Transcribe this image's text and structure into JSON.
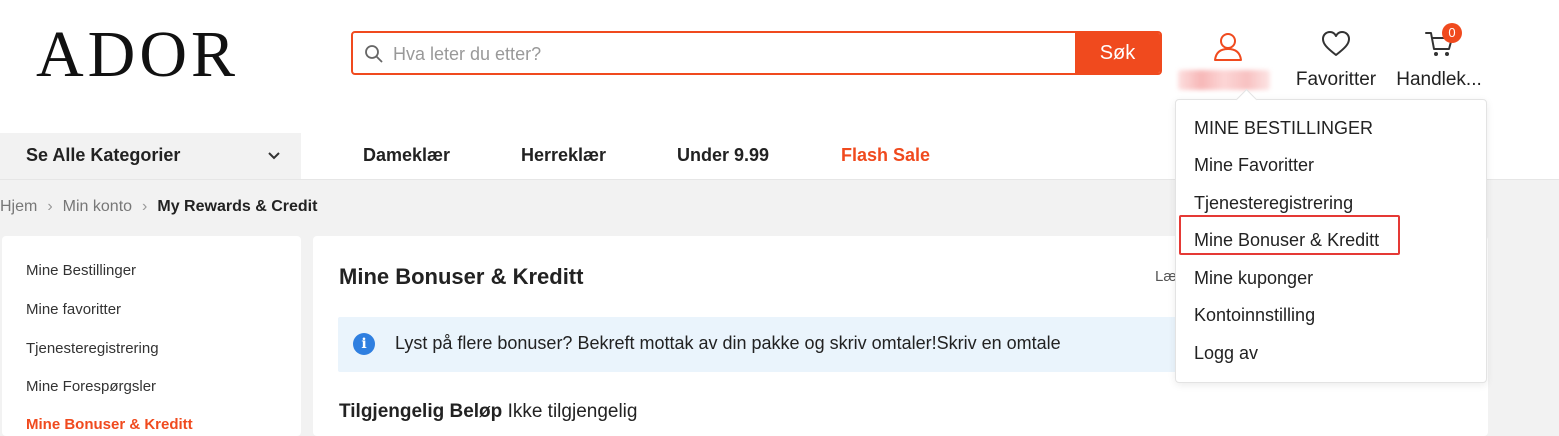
{
  "logo": "ADOR",
  "search": {
    "placeholder": "Hva leter du etter?",
    "button_label": "Søk"
  },
  "header": {
    "favorites_label": "Favoritter",
    "cart_label": "Handlek...",
    "cart_count": "0"
  },
  "nav": {
    "categories_label": "Se Alle Kategorier",
    "links": [
      "Dameklær",
      "Herreklær",
      "Under 9.99",
      "Flash Sale"
    ]
  },
  "breadcrumb": [
    "Hjem",
    "Min konto",
    "My Rewards & Credit"
  ],
  "sidebar": {
    "items": [
      "Mine Bestillinger",
      "Mine favoritter",
      "Tjenesteregistrering",
      "Mine Forespørgsler",
      "Mine Bonuser & Kreditt"
    ]
  },
  "main": {
    "title": "Mine Bonuser & Kreditt",
    "side_link": "Læ",
    "info_text": "Lyst på flere bonuser? Bekreft mottak av din pakke og skriv omtaler!Skriv en omtale",
    "amount_label": "Tilgjengelig Beløp",
    "amount_value": "Ikke tilgjengelig"
  },
  "dropdown": {
    "items": [
      "MINE BESTILLINGER",
      "Mine Favoritter",
      "Tjenesteregistrering",
      "Mine Bonuser & Kreditt",
      "Mine kuponger",
      "Kontoinnstilling",
      "Logg av"
    ]
  },
  "colors": {
    "accent": "#f04a1e",
    "info_bg": "#eaf4fc",
    "highlight_border": "#e53935"
  }
}
